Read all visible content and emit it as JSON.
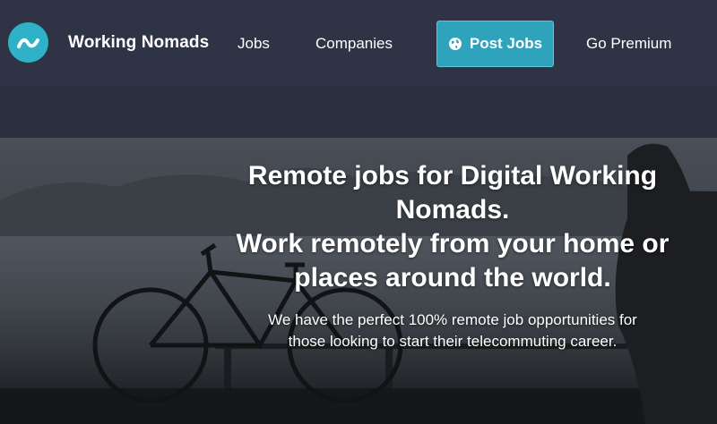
{
  "nav": {
    "brand": "Working Nomads",
    "logo_icon": "wave-logo-icon",
    "links": {
      "jobs": "Jobs",
      "companies": "Companies",
      "post_jobs": "Post Jobs",
      "premium": "Go Premium"
    },
    "post_icon": "globe-icon"
  },
  "hero": {
    "headline_lines": [
      "Remote jobs for Digital Working",
      "Nomads.",
      "Work remotely from your home or",
      "places around the world."
    ],
    "subline_lines": [
      "We have the perfect 100% remote job opportunities for",
      "those looking to start their telecommuting career."
    ]
  },
  "colors": {
    "nav_bg": "#2e3345",
    "accent": "#2fa3bc",
    "logo_bg": "#2fb1c7",
    "text": "#ffffff"
  }
}
